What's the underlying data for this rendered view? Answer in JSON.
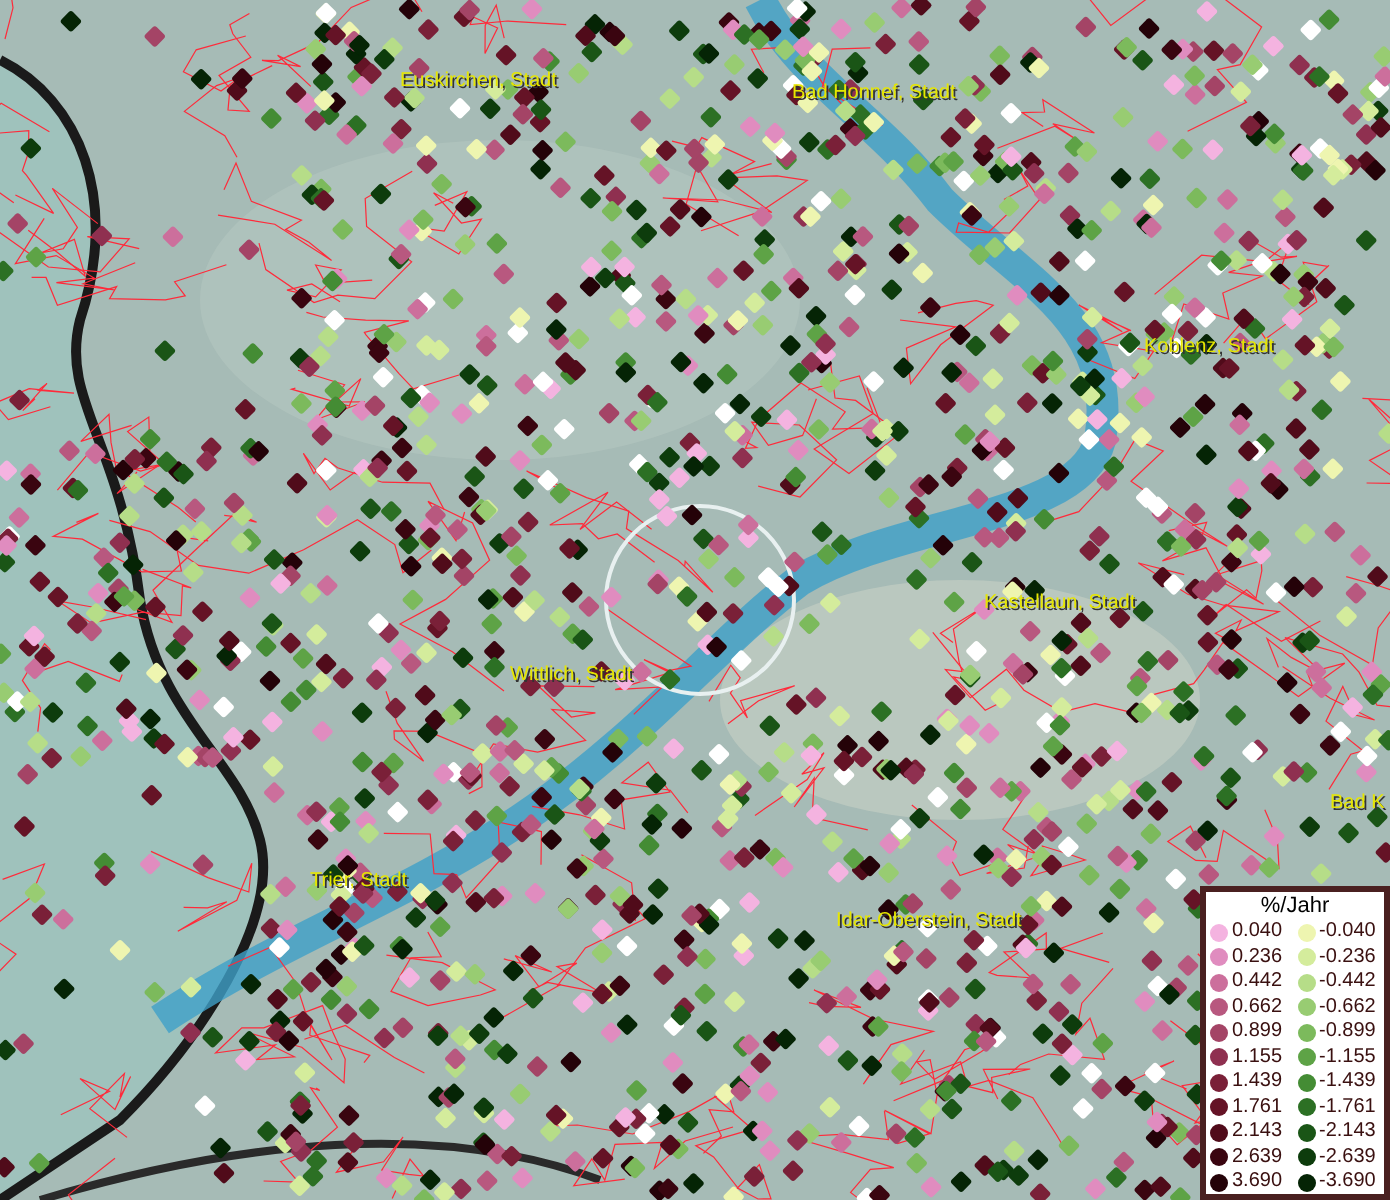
{
  "map_labels": [
    {
      "text": "Euskirchen, Stadt"
    },
    {
      "text": "Bad Honnef, Stadt"
    },
    {
      "text": "Koblenz, Stadt"
    },
    {
      "text": "Kastellaun, Stadt"
    },
    {
      "text": "Wittlich, Stadt"
    },
    {
      "text": "Trier, Stadt"
    },
    {
      "text": "Idar-Oberstein, Stadt"
    },
    {
      "text": "Bad K"
    }
  ],
  "legend": {
    "title": "%/Jahr",
    "positive": [
      {
        "label": "0.040",
        "color": "#f4b3e0"
      },
      {
        "label": "0.236",
        "color": "#e08cbf"
      },
      {
        "label": "0.442",
        "color": "#cc6f9c"
      },
      {
        "label": "0.662",
        "color": "#b8587f"
      },
      {
        "label": "0.899",
        "color": "#a44466"
      },
      {
        "label": "1.155",
        "color": "#8f3050"
      },
      {
        "label": "1.439",
        "color": "#7a2038"
      },
      {
        "label": "1.761",
        "color": "#651326"
      },
      {
        "label": "2.143",
        "color": "#500b1a"
      },
      {
        "label": "2.639",
        "color": "#3a0510"
      },
      {
        "label": "3.690",
        "color": "#240208"
      }
    ],
    "negative": [
      {
        "label": "-0.040",
        "color": "#eef5b0"
      },
      {
        "label": "-0.236",
        "color": "#d4ec9c"
      },
      {
        "label": "-0.442",
        "color": "#b6dd88"
      },
      {
        "label": "-0.662",
        "color": "#98cc72"
      },
      {
        "label": "-0.899",
        "color": "#7cba5c"
      },
      {
        "label": "-1.155",
        "color": "#5ea346"
      },
      {
        "label": "-1.439",
        "color": "#448c34"
      },
      {
        "label": "-1.761",
        "color": "#2c7024"
      },
      {
        "label": "-2.143",
        "color": "#1a5516"
      },
      {
        "label": "-2.639",
        "color": "#0d3c0c"
      },
      {
        "label": "-3.690",
        "color": "#052405"
      }
    ]
  }
}
